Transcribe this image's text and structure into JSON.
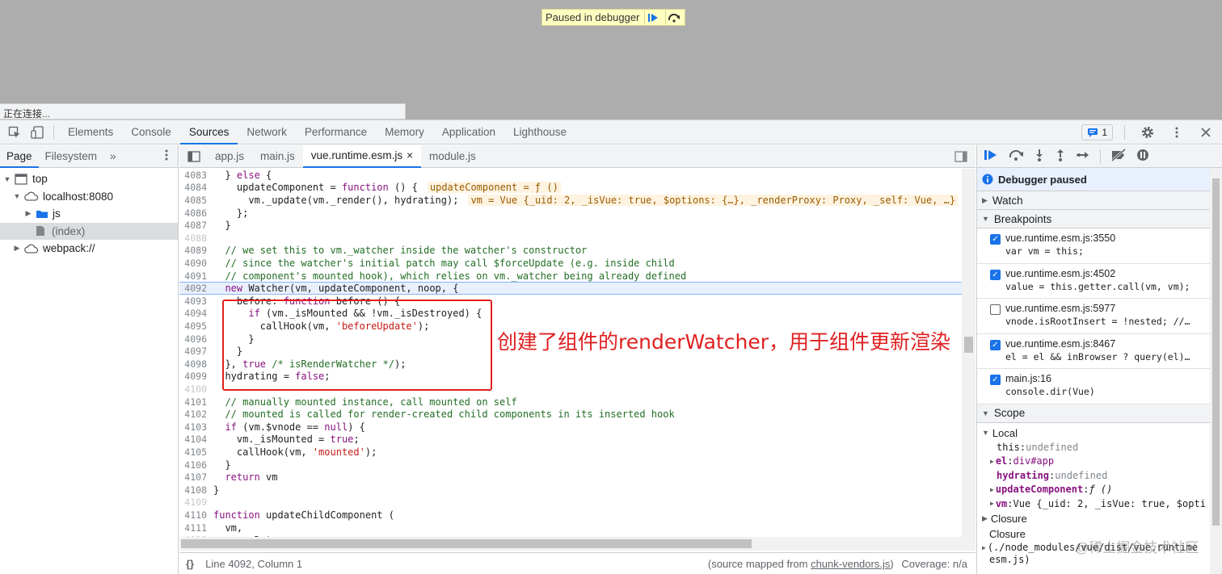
{
  "viewport": {
    "paused_banner": "Paused in debugger",
    "connecting_text": "正在连接..."
  },
  "main_tabs": [
    "Elements",
    "Console",
    "Sources",
    "Network",
    "Performance",
    "Memory",
    "Application",
    "Lighthouse"
  ],
  "active_main_tab": "Sources",
  "message_count": "1",
  "navigator": {
    "tabs": [
      "Page",
      "Filesystem"
    ],
    "more": "»",
    "tree": [
      "top",
      "localhost:8080",
      "js",
      "(index)",
      "webpack://"
    ]
  },
  "file_tabs": [
    "app.js",
    "main.js",
    "vue.runtime.esm.js",
    "module.js"
  ],
  "close_glyph": "×",
  "code": {
    "inline_values": {
      "l4084": "updateComponent = ƒ ()",
      "l4085": "vm = Vue {_uid: 2, _isVue: true, $options: {…}, _renderProxy: Proxy, _self: Vue, …}"
    }
  },
  "status": {
    "braces": "{}",
    "position": "Line 4092, Column 1",
    "source_mapped_prefix": "(source mapped from ",
    "source_mapped_file": "chunk-vendors.js",
    "source_mapped_suffix": ")",
    "coverage": "Coverage: n/a"
  },
  "annotation": "创建了组件的renderWatcher，用于组件更新渲染",
  "debugger": {
    "paused": "Debugger paused",
    "watch": "Watch",
    "breakpoints_title": "Breakpoints",
    "breakpoints": [
      {
        "file": "vue.runtime.esm.js:3550",
        "code": "var vm = this;",
        "checked": true
      },
      {
        "file": "vue.runtime.esm.js:4502",
        "code": "value = this.getter.call(vm, vm);",
        "checked": true
      },
      {
        "file": "vue.runtime.esm.js:5977",
        "code": "vnode.isRootInsert = !nested; //…",
        "checked": false
      },
      {
        "file": "vue.runtime.esm.js:8467",
        "code": "el = el && inBrowser ? query(el)…",
        "checked": true
      },
      {
        "file": "main.js:16",
        "code": "console.dir(Vue)",
        "checked": true
      }
    ],
    "scope_title": "Scope",
    "local": "Local",
    "scope": {
      "this_key": "this",
      "this_val": "undefined",
      "el_key": "el",
      "el_val": "div#app",
      "hydrating_key": "hydrating",
      "hydrating_val": "undefined",
      "uc_key": "updateComponent",
      "uc_val": "ƒ ()",
      "vm_key": "vm",
      "vm_val": "Vue {_uid: 2, _isVue: true, $opti"
    },
    "closure1": "Closure",
    "closure2": "Closure",
    "closure2_path": "(./node_modules/vue/dist/vue.runtime",
    "closure2_path2": "esm.js)"
  },
  "watermark": "@稀土掘金技术社区"
}
